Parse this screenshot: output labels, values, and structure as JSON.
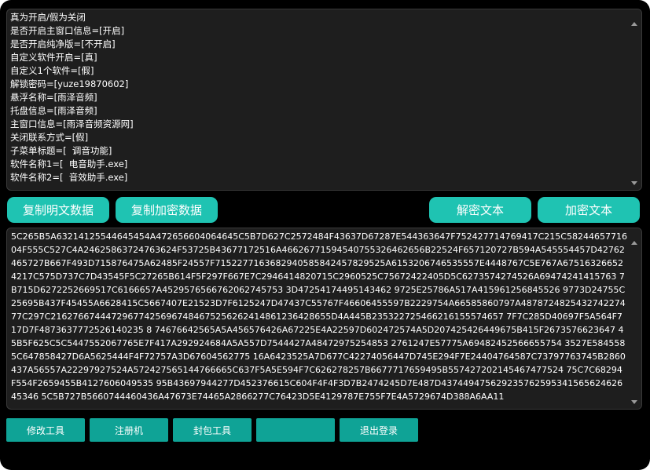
{
  "config_text": {
    "lines": [
      "真为开启/假为关闭",
      "是否开启主窗口信息=[开启]",
      "是否开启纯净版=[不开启]",
      "自定义软件开启=[真]",
      "自定义1个软件=[假]",
      "解锁密码=[yuze19870602]",
      "悬浮名称=[雨泽音频]",
      "托盘信息=[雨泽音频]",
      "主窗口信息=[雨泽音频资源网]",
      "关闭联系方式=[假]",
      "子菜单标题=[  调音功能]",
      "软件名称1=[  电音助手.exe]",
      "软件名称2=[  音效助手.exe]"
    ]
  },
  "buttons": {
    "copy_plain": "复制明文数据",
    "copy_encrypted": "复制加密数据",
    "decrypt": "解密文本",
    "encrypt": "加密文本"
  },
  "cipher_text": "5C265B5A63214125544645454A472656604064645C5B7D627C2572484F43637D67287E544363647F752427714769417C215C5824465771604F555C527C4A24625863724763624F53725B43677172516A46626771594540755326462656B22524F657120727B594A545554457D42762465727B667F493D715876475A62485F24557F7152277163682940585842457829525A6153206746535557E4448767C5E767A675163266524217C575D737C7D43545F5C27265B614F5F297F667E7C2946414820715C2960525C75672422405D5C6273574274526A69474241415763 7B715D6272252669517C6166657A4529576566762062745753 3D47254174495143462 9725E25786A517A415961256845526 9773D24755C25695B437F45455A6628415C5667407E21523D7F6125247D47437C55767F46606455597B2229754A66585860797A487872482543274227477C297C216276674447296774256967484675256262414861236428655D4A445B235322725466216155574657 7F7C285D40697F5A564F717D7F4873637772526140235 8 74676642565A5A456576426A67225E4A22597D602472574A5D207425426449675B415F2673576623647 45B5F625C5C5447552067765E7F417A292924684A5A557D7544427A48472975254853 2761247E57775A69482452566655754 3527E5845585C647858427D6A5625444F4F72757A3D67604562775 16A6423525A7D677C42274056447D745E294F7E24404764587C73797763745B2860437A56557A22297927524A572427565144766665C637F5A5E594F7C626278257B6677717659495B557427202145467477524 75C7C68294F554F2659455B4127606049535 95B43697944277D452376615C604F4F4F3D7B2474245D7E487D43744947562923576259534156562462645346 5C5B727B5660744460436A47673E74465A2866277C76423D5E4129787E755F7E4A5729674D388A6AA11",
  "toolbar": {
    "modify": "修改工具",
    "register": "注册机",
    "pack": "封包工具",
    "blank": "",
    "logout": "退出登录"
  },
  "colors": {
    "window_bg": "#000000",
    "panel_bg": "#1e1e1e",
    "accent": "#1fc3b2",
    "toolbar_button": "#0fa396"
  }
}
